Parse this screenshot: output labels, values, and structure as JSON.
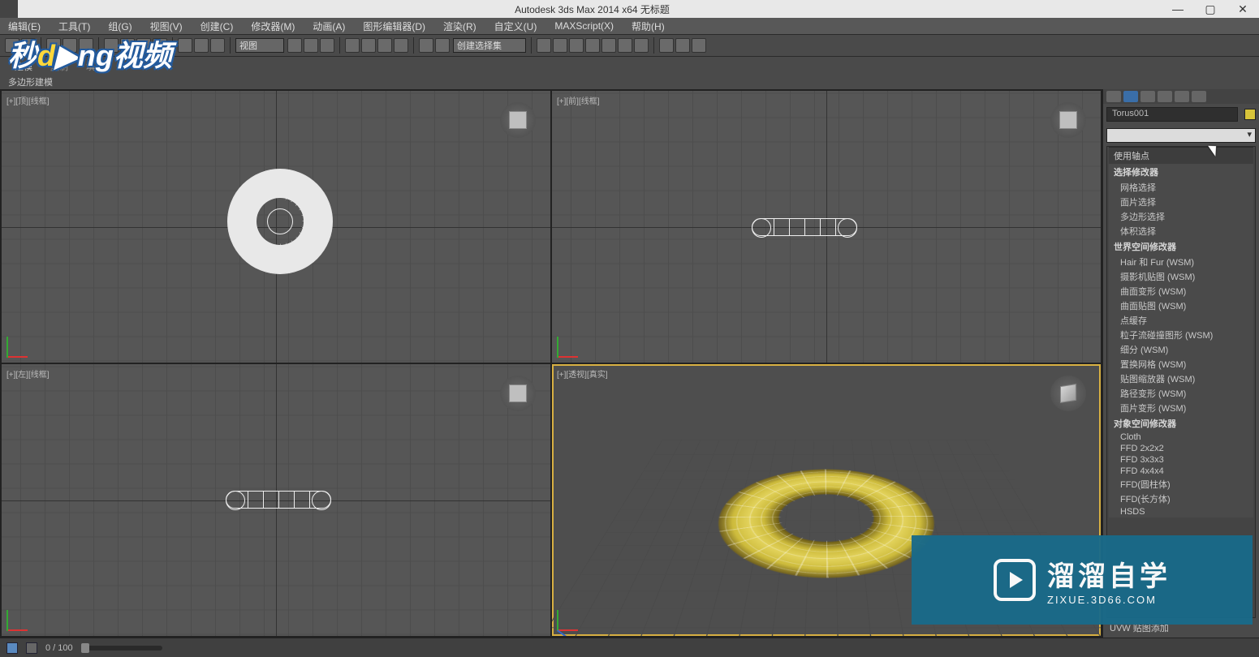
{
  "title": "Autodesk 3ds Max  2014 x64     无标题",
  "menubar": [
    "编辑(E)",
    "工具(T)",
    "组(G)",
    "视图(V)",
    "创建(C)",
    "修改器(M)",
    "动画(A)",
    "图形编辑器(D)",
    "渲染(R)",
    "自定义(U)",
    "MAXScript(X)",
    "帮助(H)"
  ],
  "toolbar": {
    "view_dropdown": "视图",
    "select_set": "创建选择集"
  },
  "ribbon": {
    "chips": [
      "建模",
      "复制",
      "填充"
    ],
    "subtext": "多边形建模"
  },
  "viewports": {
    "top": {
      "label": "[+][顶][线框]"
    },
    "front": {
      "label": "[+][前][线框]"
    },
    "left": {
      "label": "[+][左][线框]"
    },
    "persp": {
      "label": "[+][透视][真实]"
    }
  },
  "command_panel": {
    "object_name": "Torus001",
    "section_header": "使用轴点",
    "categories": [
      {
        "title": "选择修改器",
        "items": [
          "网格选择",
          "面片选择",
          "多边形选择",
          "体积选择"
        ]
      },
      {
        "title": "世界空间修改器",
        "items": [
          "Hair 和 Fur (WSM)",
          "摄影机贴图 (WSM)",
          "曲面变形 (WSM)",
          "曲面贴图 (WSM)",
          "点缓存",
          "粒子流碰撞图形 (WSM)",
          "细分 (WSM)",
          "置换网格 (WSM)",
          "贴图缩放器 (WSM)",
          "路径变形 (WSM)",
          "面片变形 (WSM)"
        ]
      },
      {
        "title": "对象空间修改器",
        "items": [
          "Cloth",
          "FFD 2x2x2",
          "FFD 3x3x3",
          "FFD 4x4x4",
          "FFD(圆柱体)",
          "FFD(长方体)",
          "HSDS"
        ]
      }
    ],
    "footer_item": "UVW 贴图添加"
  },
  "statusbar": {
    "frame": "0 / 100"
  },
  "watermark": {
    "big": "溜溜自学",
    "small": "ZIXUE.3D66.COM"
  },
  "overlay_logo": {
    "t1": "秒",
    "t2": "d",
    "t3": "ng",
    "t4": "视频"
  }
}
